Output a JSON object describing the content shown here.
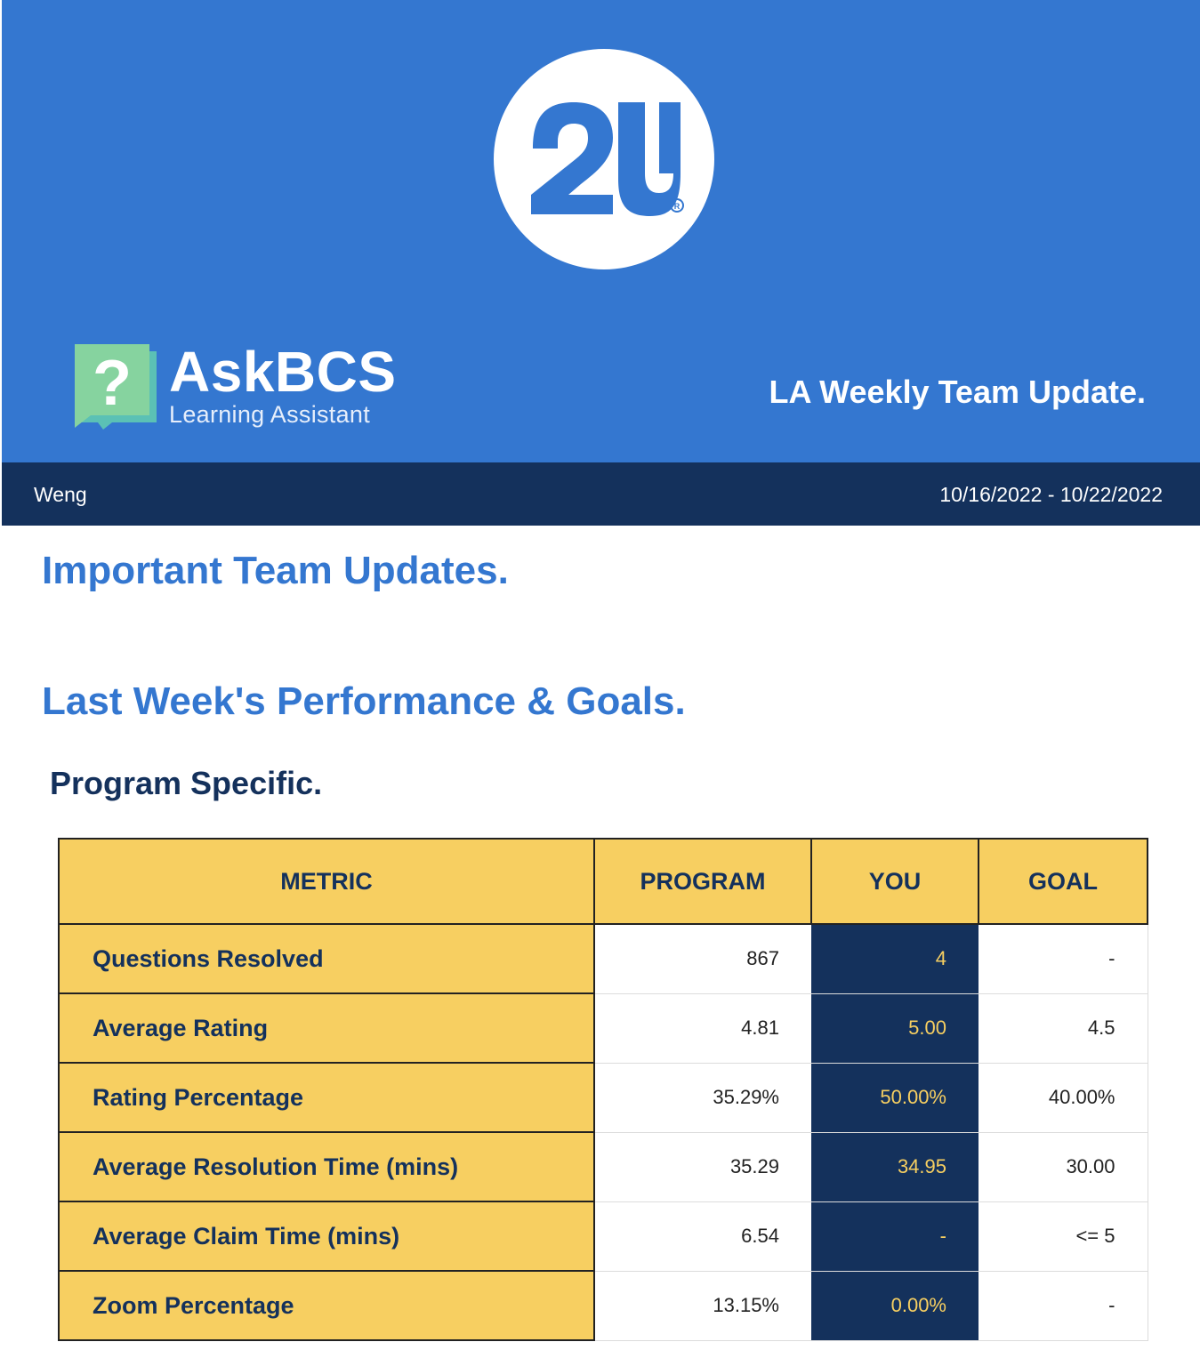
{
  "brand": {
    "logo_text": "2U",
    "askbcs_title": "AskBCS",
    "askbcs_subtitle": "Learning Assistant",
    "header_title": "LA Weekly Team Update."
  },
  "info_bar": {
    "name": "Weng",
    "date_range": "10/16/2022 - 10/22/2022"
  },
  "sections": {
    "team_updates_heading": "Important Team Updates.",
    "performance_heading": "Last Week's Performance & Goals.",
    "program_specific_heading": "Program Specific."
  },
  "table": {
    "headers": [
      "METRIC",
      "PROGRAM",
      "YOU",
      "GOAL"
    ],
    "rows": [
      {
        "metric": "Questions Resolved",
        "program": "867",
        "you": "4",
        "goal": "-"
      },
      {
        "metric": "Average Rating",
        "program": "4.81",
        "you": "5.00",
        "goal": "4.5"
      },
      {
        "metric": "Rating Percentage",
        "program": "35.29%",
        "you": "50.00%",
        "goal": "40.00%"
      },
      {
        "metric": "Average Resolution Time (mins)",
        "program": "35.29",
        "you": "34.95",
        "goal": "30.00"
      },
      {
        "metric": "Average Claim Time (mins)",
        "program": "6.54",
        "you": "-",
        "goal": "<= 5"
      },
      {
        "metric": "Zoom Percentage",
        "program": "13.15%",
        "you": "0.00%",
        "goal": "-"
      }
    ]
  },
  "colors": {
    "header_blue": "#3477d0",
    "navy": "#14315c",
    "gold": "#f7cf61",
    "badge_green": "#7dcf9b"
  },
  "icons": [
    "question-mark-icon",
    "registered-trademark-icon"
  ]
}
